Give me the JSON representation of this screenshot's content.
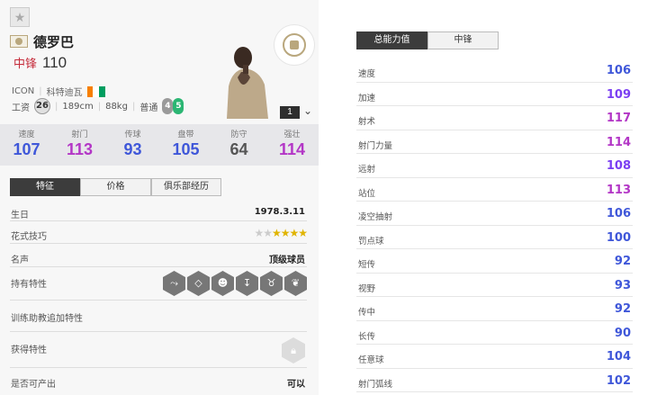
{
  "player": {
    "name": "德罗巴",
    "position": "中锋",
    "overall": "110",
    "card_type": "ICON",
    "nationality": "科特迪瓦",
    "wage_label": "工资",
    "wage": "26",
    "height": "189cm",
    "weight": "88kg",
    "body_type": "普通",
    "weak_foot_left": "4",
    "weak_foot_right": "5",
    "level": "1"
  },
  "colors": {
    "accent_purple": "#7b3ff2",
    "stat_blue": "#3f57d9",
    "stat_grey": "#555555",
    "stat_magenta": "#b336c6",
    "position_red": "#c52b3a",
    "flag_orange": "#f77f00",
    "flag_white": "#ffffff",
    "flag_green": "#009e60"
  },
  "summary_stats": [
    {
      "label": "速度",
      "value": "107",
      "color": "#3f57d9"
    },
    {
      "label": "射门",
      "value": "113",
      "color": "#b336c6"
    },
    {
      "label": "传球",
      "value": "93",
      "color": "#3f57d9"
    },
    {
      "label": "盘带",
      "value": "105",
      "color": "#3f57d9"
    },
    {
      "label": "防守",
      "value": "64",
      "color": "#555555"
    },
    {
      "label": "强壮",
      "value": "114",
      "color": "#b336c6"
    }
  ],
  "left_tabs": [
    "特征",
    "价格",
    "俱乐部经历"
  ],
  "info": {
    "birthday_label": "生日",
    "birthday": "1978.3.11",
    "skill_label": "花式技巧",
    "skill_stars": 4,
    "reputation_label": "名声",
    "reputation": "顶级球员",
    "traits_label": "持有特性",
    "traits_icons": [
      "dive-header-icon",
      "diamond-icon",
      "power-header-icon",
      "finesse-shot-icon",
      "bull-icon",
      "lungs-icon"
    ],
    "coach_traits_label": "训练助教追加特性",
    "acquired_traits_label": "获得特性",
    "obtainable_label": "是否可产出",
    "obtainable": "可以"
  },
  "right_tabs": [
    "总能力值",
    "中锋"
  ],
  "attributes": [
    {
      "label": "速度",
      "value": "106",
      "color": "#3f57d9"
    },
    {
      "label": "加速",
      "value": "109",
      "color": "#7b3ff2"
    },
    {
      "label": "射术",
      "value": "117",
      "color": "#b336c6"
    },
    {
      "label": "射门力量",
      "value": "114",
      "color": "#b336c6"
    },
    {
      "label": "远射",
      "value": "108",
      "color": "#7b3ff2"
    },
    {
      "label": "站位",
      "value": "113",
      "color": "#b336c6"
    },
    {
      "label": "凌空抽射",
      "value": "106",
      "color": "#3f57d9"
    },
    {
      "label": "罚点球",
      "value": "100",
      "color": "#3f57d9"
    },
    {
      "label": "短传",
      "value": "92",
      "color": "#3f57d9"
    },
    {
      "label": "视野",
      "value": "93",
      "color": "#3f57d9"
    },
    {
      "label": "传中",
      "value": "92",
      "color": "#3f57d9"
    },
    {
      "label": "长传",
      "value": "90",
      "color": "#3f57d9"
    },
    {
      "label": "任意球",
      "value": "104",
      "color": "#3f57d9"
    },
    {
      "label": "射门弧线",
      "value": "102",
      "color": "#3f57d9"
    }
  ]
}
